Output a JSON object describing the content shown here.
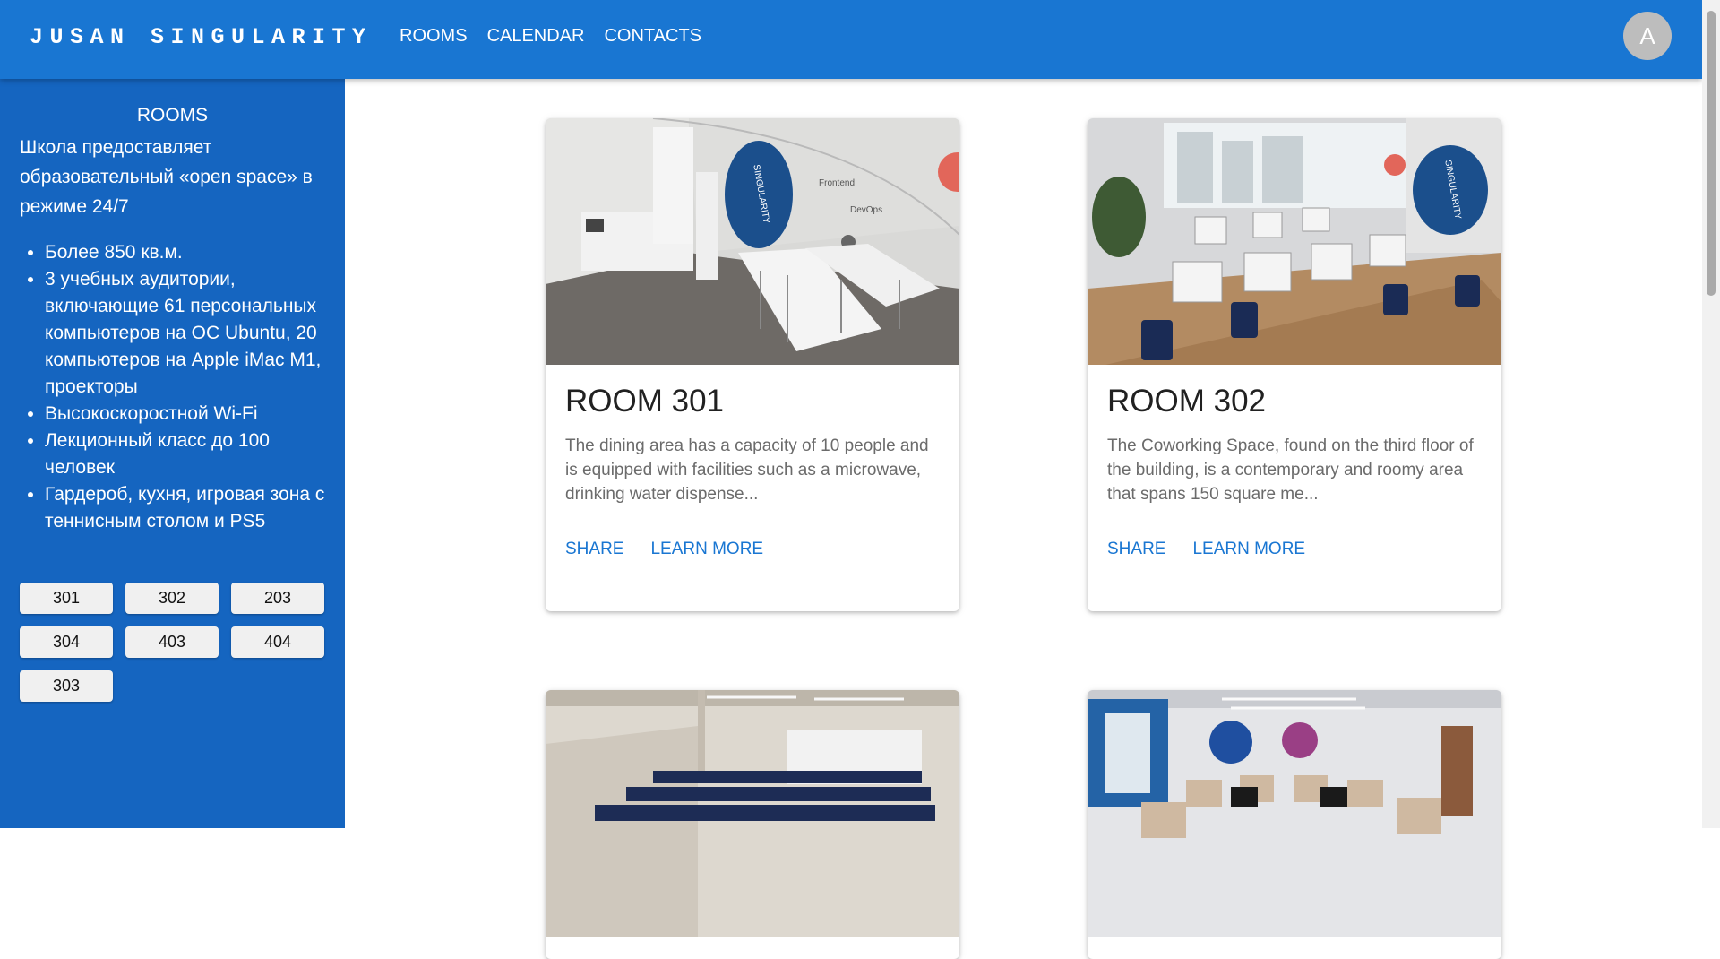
{
  "header": {
    "brand": "JUSAN SINGULARITY",
    "nav": [
      "ROOMS",
      "CALENDAR",
      "CONTACTS"
    ],
    "avatar_letter": "A"
  },
  "sidebar": {
    "title": "ROOMS",
    "intro": "Школа предоставляет образовательный «open space» в режиме 24/7",
    "features": [
      "Более 850 кв.м.",
      "3 учебных аудитории, включающие 61 персональных компьютеров на ОС Ubuntu, 20 компьютеров на Apple iMac M1, проекторы",
      "Высокоскоростной Wi-Fi",
      "Лекционный класс до 100 человек",
      "Гардероб, кухня, игровая зона с теннисным столом и PS5"
    ],
    "room_buttons": [
      "301",
      "302",
      "203",
      "304",
      "403",
      "404",
      "303"
    ]
  },
  "cards": [
    {
      "title": "ROOM 301",
      "description": "The dining area has a capacity of 10 people and is equipped with facilities such as a microwave, drinking water dispense...",
      "share": "SHARE",
      "learn_more": "LEARN MORE",
      "image_logo": "SINGULARITY",
      "image_wall_text_1": "Frontend",
      "image_wall_text_2": "DevOps"
    },
    {
      "title": "ROOM 302",
      "description": "The Coworking Space, found on the third floor of the building, is a contemporary and roomy area that spans 150 square me...",
      "share": "SHARE",
      "learn_more": "LEARN MORE",
      "image_logo": "SINGULARITY"
    },
    {},
    {}
  ],
  "colors": {
    "app_bar": "#1976d2",
    "sidebar": "#1565c0",
    "accent": "#1976d2",
    "avatar": "#bdbdbd"
  }
}
